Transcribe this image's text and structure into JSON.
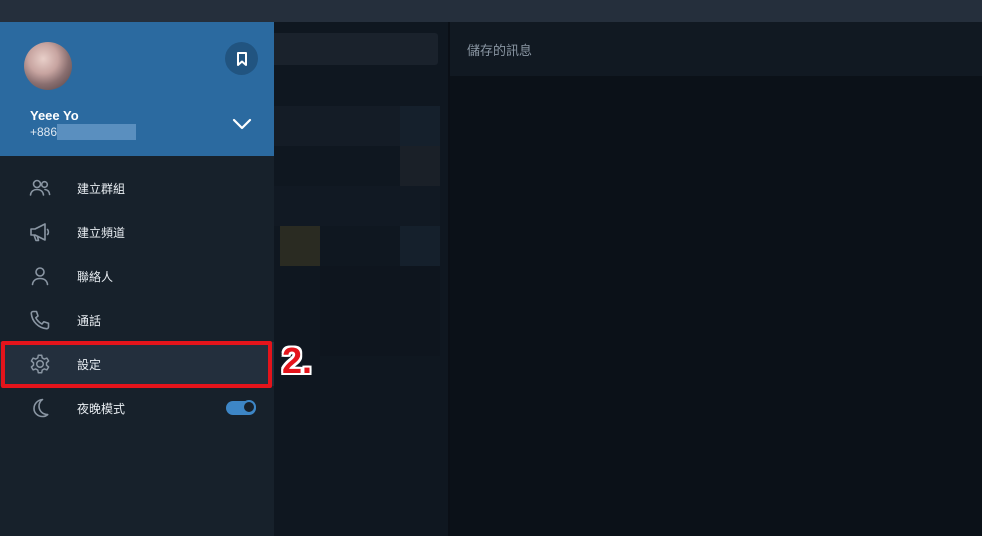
{
  "drawer": {
    "user_name": "Yeee Yo",
    "user_phone": "+886",
    "items": [
      {
        "label": "建立群組",
        "icon": "group-icon"
      },
      {
        "label": "建立頻道",
        "icon": "megaphone-icon"
      },
      {
        "label": "聯絡人",
        "icon": "contact-icon"
      },
      {
        "label": "通話",
        "icon": "phone-icon"
      },
      {
        "label": "設定",
        "icon": "gear-icon"
      },
      {
        "label": "夜晚模式",
        "icon": "moon-icon",
        "toggle_on": true
      }
    ]
  },
  "chat": {
    "title": "儲存的訊息"
  },
  "annotation": {
    "step": "2."
  },
  "colors": {
    "accent": "#2b6aa0",
    "highlight": "#e4141b",
    "toggle": "#3d86c6"
  }
}
